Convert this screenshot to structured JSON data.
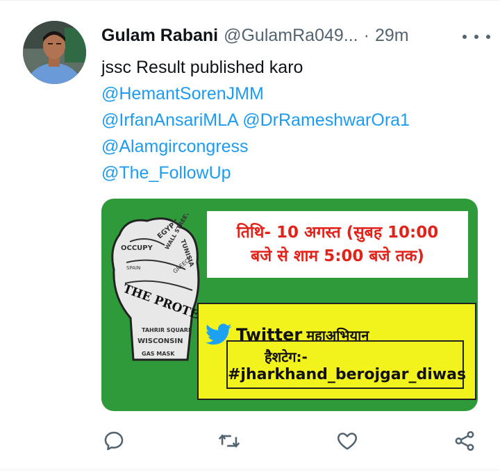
{
  "tweet": {
    "author_name": "Gulam Rabani",
    "author_handle": "@GulamRa049...",
    "separator": "·",
    "time_ago": "29m",
    "text_line1": "jssc Result published karo",
    "mention1": "@HemantSorenJMM",
    "mention2": "@IrfanAnsariMLA",
    "mention3": "@DrRameshwarOra1",
    "mention4": "@Alamgircongress",
    "mention5": "@The_FollowUp"
  },
  "media": {
    "date_line1": "तिथि- 10 अगस्त (सुबह 10:00",
    "date_line2": "बजे से शाम 5:00 बजे तक)",
    "twitter_word": "Twitter",
    "campaign_word": "महाअभियान",
    "hashtag_label": "हैशटेग:-",
    "hashtag": "#jharkhand_berojgar_diwas",
    "poster_words": [
      "OCCUPY",
      "EGYPT",
      "WALL STREET",
      "TUNISIA",
      "GREECE",
      "SPAIN",
      "THE PROTESTER",
      "TAHRIR SQUARE",
      "WISCONSIN",
      "GAS MASK"
    ]
  },
  "icons": {
    "more": "more-icon",
    "reply": "reply-icon",
    "retweet": "retweet-icon",
    "like": "like-icon",
    "share": "share-icon"
  },
  "colors": {
    "link": "#1d9bf0",
    "secondary": "#536471",
    "media_green": "#2e9a3a",
    "media_yellow": "#f2f21d",
    "date_red": "#e2231a"
  }
}
